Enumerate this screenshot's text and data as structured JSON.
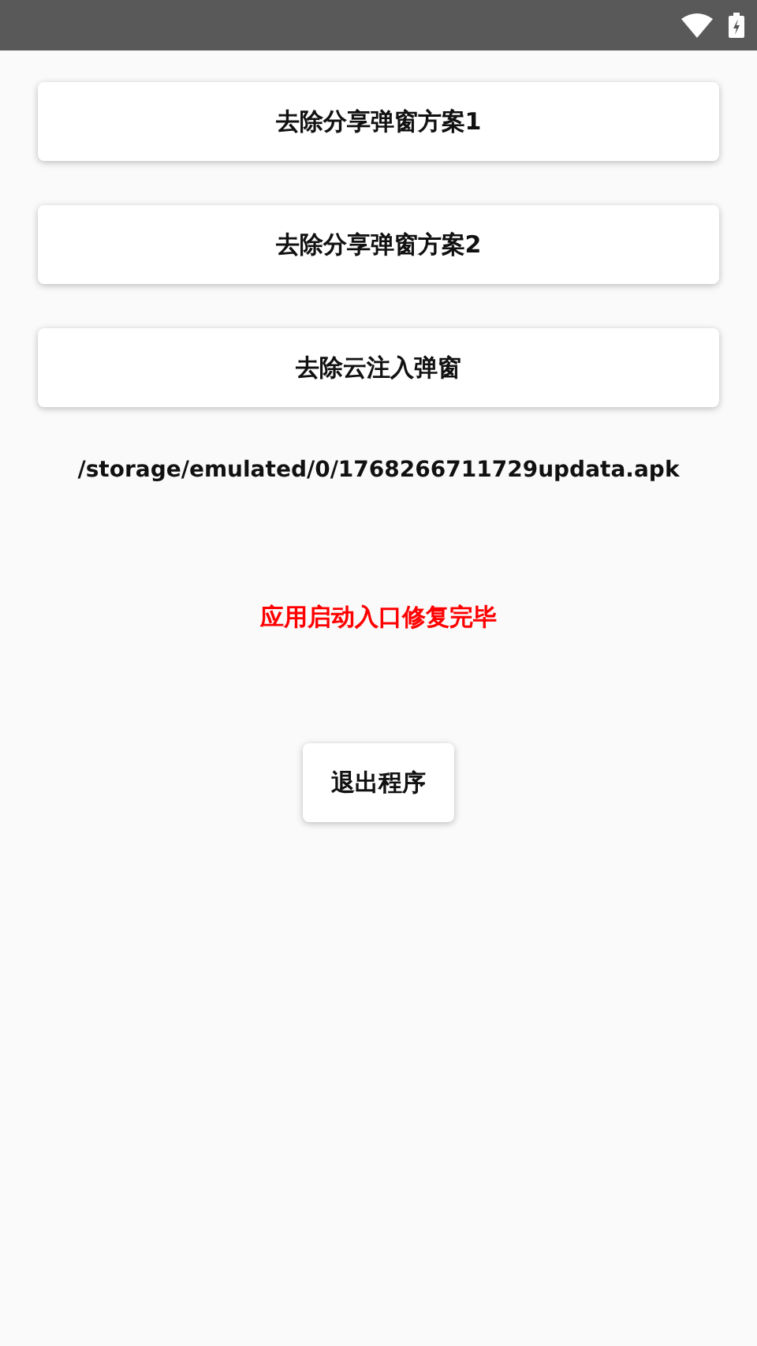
{
  "buttons": [
    "去除分享弹窗方案1",
    "去除分享弹窗方案2",
    "去除云注入弹窗"
  ],
  "path_text": "/storage/emulated/0/1768266711729updata.apk",
  "status_message": "应用启动入口修复完毕",
  "exit_button": "退出程序"
}
